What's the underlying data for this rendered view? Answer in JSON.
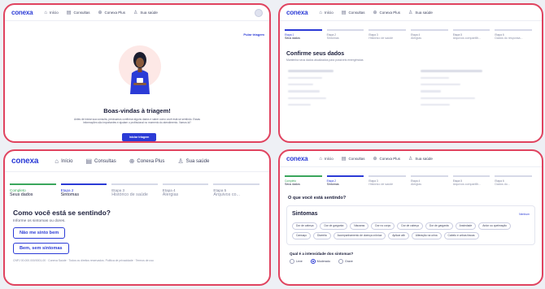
{
  "colors": {
    "accent": "#2b3bd6",
    "frame": "#e0435f",
    "success": "#3aa65c"
  },
  "nav": {
    "logo": "conexa",
    "items": [
      {
        "label": "Início",
        "icon": "home-icon"
      },
      {
        "label": "Consultas",
        "icon": "calendar-icon"
      },
      {
        "label": "Conexa Plus",
        "icon": "plus-circle-icon"
      },
      {
        "label": "Sua saúde",
        "icon": "person-icon"
      }
    ]
  },
  "welcome": {
    "skip_label": "Pular triagem",
    "title": "Boas-vindas à triagem!",
    "text": "Antes de iniciar sua consulta, precisamos confirmar alguns dados e saber como você está se sentindo. Essas informações são importantes e ajudam o profissional no momento do atendimento. Vamos lá?",
    "start_label": "Iniciar triagem"
  },
  "steps_p2": [
    {
      "num": "Etapa 1",
      "name": "Seus dados",
      "state": "active"
    },
    {
      "num": "Etapa 2",
      "name": "Sintomas",
      "state": "todo"
    },
    {
      "num": "Etapa 3",
      "name": "Histórico de saúde",
      "state": "todo"
    },
    {
      "num": "Etapa 4",
      "name": "Alergias",
      "state": "todo"
    },
    {
      "num": "Etapa 5",
      "name": "Arquivos compartilh...",
      "state": "todo"
    },
    {
      "num": "Etapa 6",
      "name": "Dados do responsá...",
      "state": "todo"
    }
  ],
  "confirm": {
    "title": "Confirme seus dados",
    "subtitle": "Mantenha seus dados atualizados para possíveis emergências"
  },
  "steps_p3": [
    {
      "num": "Completo",
      "name": "Seus dados",
      "state": "done"
    },
    {
      "num": "Etapa 2",
      "name": "Sintomas",
      "state": "active"
    },
    {
      "num": "Etapa 3",
      "name": "Histórico de saúde",
      "state": "todo"
    },
    {
      "num": "Etapa 4",
      "name": "Alergias",
      "state": "todo"
    },
    {
      "num": "Etapa 5",
      "name": "Arquivos co...",
      "state": "todo"
    }
  ],
  "feeling": {
    "title": "Como você está se sentindo?",
    "subtitle": "Informe os sintomas ou dores.",
    "option_1": "Não me sinto bem",
    "option_2": "Bem, sem sintomas",
    "legal": "CNPJ 00.000.000/0001-00 · Conexa Saúde · Todos os direitos reservados. Política de privacidade · Termos de uso"
  },
  "steps_p4": [
    {
      "num": "Completo",
      "name": "Seus dados",
      "state": "done"
    },
    {
      "num": "Etapa 2",
      "name": "Sintomas",
      "state": "active"
    },
    {
      "num": "Etapa 3",
      "name": "Histórico de saúde",
      "state": "todo"
    },
    {
      "num": "Etapa 4",
      "name": "Alergias",
      "state": "todo"
    },
    {
      "num": "Etapa 5",
      "name": "Arquivos compartilh...",
      "state": "todo"
    },
    {
      "num": "Etapa 6",
      "name": "Dados do...",
      "state": "todo"
    }
  ],
  "symptoms": {
    "question": "O que você está sentindo?",
    "card_title": "Sintomas",
    "card_link": "Nenhum",
    "chips": [
      "Dor de cabeça",
      "Dor de garganta",
      "Náuseas",
      "Dor no corpo",
      "Dor de cabeça",
      "Dor de garganta",
      "Ansiedade",
      "Ardor ou queimação",
      "Cansaço",
      "Diarréia",
      "Acompanhamento de doença crônica",
      "Aplicar atb",
      "Alteração na urina",
      "Cabelo e unhas fracas"
    ],
    "intensity_q": "Qual é a intensidade dos sintomas?",
    "intensity": [
      {
        "label": "Leve",
        "selected": false
      },
      {
        "label": "Moderado",
        "selected": true
      },
      {
        "label": "Grave",
        "selected": false
      }
    ]
  }
}
